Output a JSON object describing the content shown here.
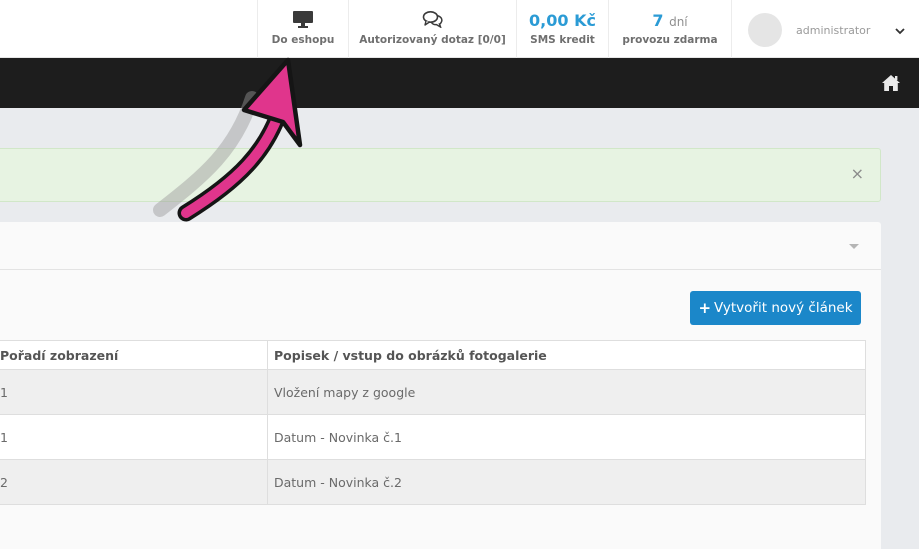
{
  "topbar": {
    "eshop": {
      "icon": "monitor-icon",
      "label": "Do eshopu"
    },
    "inquiry": {
      "icon": "chat-bubbles-icon",
      "label": "Autorizovaný dotaz [0/0]"
    },
    "sms": {
      "value": "0,00 Kč",
      "label": "SMS kredit"
    },
    "trial": {
      "value": "7",
      "unit": "dní",
      "label": "provozu zdarma"
    },
    "user": {
      "name": "administrator",
      "icon": "chevron-down-icon"
    }
  },
  "navbar": {
    "home_icon": "home-icon"
  },
  "alert": {
    "close": "×"
  },
  "panel": {
    "toggle_icon": "caret-down-icon",
    "create_button": {
      "icon": "+",
      "label": "Vytvořit nový článek"
    }
  },
  "table": {
    "headers": [
      "Pořadí zobrazení",
      "Popisek / vstup do obrázků fotogalerie"
    ],
    "rows": [
      {
        "order": "1",
        "title": "Vložení mapy z google"
      },
      {
        "order": "1",
        "title": "Datum - Novinka č.1"
      },
      {
        "order": "2",
        "title": "Datum - Novinka č.2"
      }
    ]
  },
  "colors": {
    "accent": "#2b9bd5",
    "button": "#1b87c9",
    "navbar": "#1d1d1d",
    "alert_bg": "#e7f3e2",
    "arrow": "#e0358c"
  }
}
